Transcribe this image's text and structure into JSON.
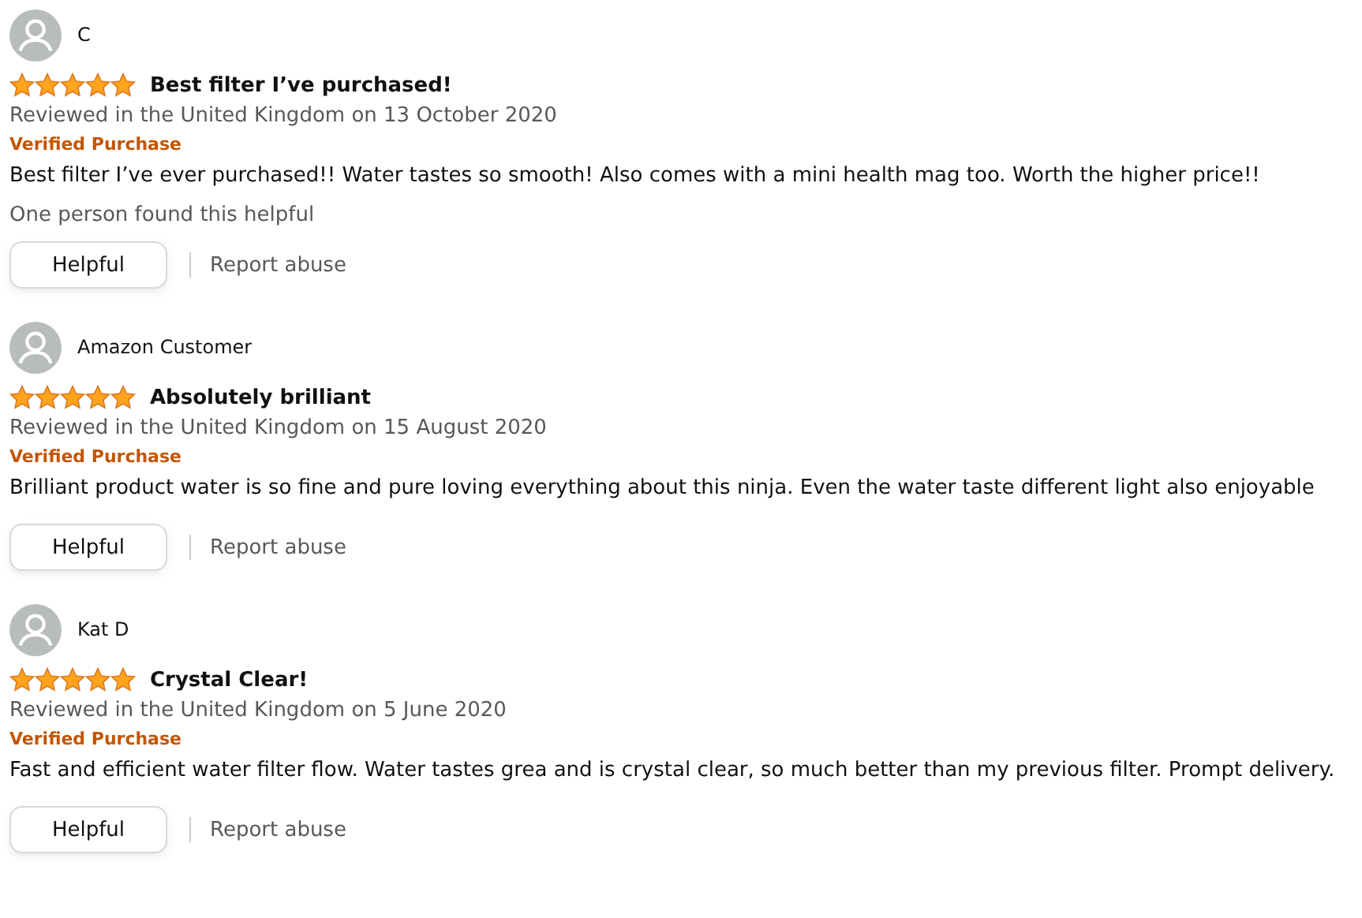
{
  "reviews": [
    {
      "author": "C",
      "stars": 5,
      "title": "Best filter I’ve purchased!",
      "meta": "Reviewed in the United Kingdom on 13 October 2020",
      "badge": "Verified Purchase",
      "body": "Best filter I’ve ever purchased!! Water tastes so smooth! Also comes with a mini health mag too. Worth the higher price!!",
      "helpful_count": "One person found this helpful",
      "helpful_button": "Helpful",
      "report_link": "Report abuse"
    },
    {
      "author": "Amazon Customer",
      "stars": 5,
      "title": "Absolutely brilliant",
      "meta": "Reviewed in the United Kingdom on 15 August 2020",
      "badge": "Verified Purchase",
      "body": "Brilliant product water is so fine and pure loving everything about this ninja. Even the water taste different light also enjoyable",
      "helpful_button": "Helpful",
      "report_link": "Report abuse"
    },
    {
      "author": "Kat D",
      "stars": 5,
      "title": "Crystal Clear!",
      "meta": "Reviewed in the United Kingdom on 5 June 2020",
      "badge": "Verified Purchase",
      "body": "Fast and efficient water filter flow. Water tastes grea and is crystal clear, so much better than my previous filter. Prompt delivery.",
      "helpful_button": "Helpful",
      "report_link": "Report abuse"
    }
  ]
}
